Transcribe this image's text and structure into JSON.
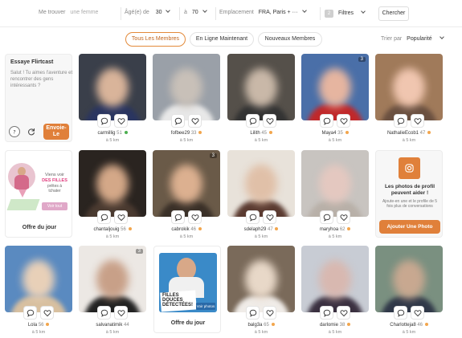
{
  "filters": {
    "me_trouver_label": "Me trouver",
    "me_trouver_value": "une femme",
    "age_label": "Âgé(e) de",
    "age_min": "30",
    "age_to": "à",
    "age_max": "70",
    "location_label": "Emplacement",
    "location_value": "FRA, Paris + ···",
    "filters_count": "2",
    "filters_label": "Filtres",
    "search_label": "Chercher"
  },
  "tabs": [
    {
      "label": "Tous Les Membres"
    },
    {
      "label": "En Ligne Maintenant"
    },
    {
      "label": "Nouveaux Membres"
    }
  ],
  "sort": {
    "label": "Trier par",
    "value": "Popularité"
  },
  "flirtcast": {
    "title": "Essaye Flirtcast",
    "text": "Salut ! Tu aimes l'aventure et rencontrer des gens intéressants ?",
    "send_label": "Envoie-Le"
  },
  "offer1": {
    "text1": "Viens voir",
    "highlight": "DES FILLES",
    "text2": "prêtes à tchater",
    "button": "Voir tout",
    "title": "Offre du jour"
  },
  "offer2": {
    "line1": "FILLES",
    "line2": "DOUCES",
    "line3": "DÉTECTÉES!",
    "button": "Voir photos",
    "title": "Offre du jour"
  },
  "photo_promo": {
    "title": "Les photos de profil peuvent aider !",
    "text": "Ajoute-en une et le profile de 5 fois plus de conversations",
    "button": "Ajouter Une Photo"
  },
  "members": [
    {
      "name": "carmillig",
      "age": "51",
      "dist": "à 5 km",
      "status": "green",
      "photos": "",
      "bg": "#3a3f4a",
      "face": "#d9b49a",
      "shirt": "#2a3560"
    },
    {
      "name": "fofbee29",
      "age": "33",
      "dist": "à 5 km",
      "status": "orange",
      "photos": "",
      "bg": "#9aa0a8",
      "face": "#c8c0b8",
      "shirt": "#e8e8e8"
    },
    {
      "name": "Lilith",
      "age": "45",
      "dist": "à 5 km",
      "status": "orange",
      "photos": "",
      "bg": "#55504a",
      "face": "#c9b8a8",
      "shirt": "#333"
    },
    {
      "name": "Maya4",
      "age": "35",
      "dist": "à 5 km",
      "status": "orange",
      "photos": "3",
      "bg": "#4a6fa8",
      "face": "#e6b5a0",
      "shirt": "#c0282a"
    },
    {
      "name": "NathalieEcob1",
      "age": "47",
      "dist": "à 5 km",
      "status": "orange",
      "photos": "",
      "bg": "#a07a5a",
      "face": "#f0c6b0",
      "shirt": "#6a5040"
    },
    {
      "name": "chantaljouig",
      "age": "56",
      "dist": "à 5 km",
      "status": "orange",
      "photos": "",
      "bg": "#2a2420",
      "face": "#d4a888",
      "shirt": "#4a3a30"
    },
    {
      "name": "cabrokik",
      "age": "46",
      "dist": "à 5 km",
      "status": "orange",
      "photos": "3",
      "bg": "#6a5a48",
      "face": "#dcb090",
      "shirt": "#3a3028"
    },
    {
      "name": "sdelaph29",
      "age": "47",
      "dist": "à 5 km",
      "status": "orange",
      "photos": "",
      "bg": "#e8e2da",
      "face": "#e0c0a8",
      "shirt": "#5a3a30"
    },
    {
      "name": "maryhoa",
      "age": "62",
      "dist": "à 5 km",
      "status": "orange",
      "photos": "",
      "bg": "#c8c4c0",
      "face": "#e4c8c0",
      "shirt": "#b8b0a8"
    },
    {
      "name": "Lola",
      "age": "56",
      "dist": "à 5 km",
      "status": "orange",
      "photos": "",
      "bg": "#5a8ac0",
      "face": "#e8d0b8",
      "shirt": "#d8c0a0"
    },
    {
      "name": "salvanatimik",
      "age": "44",
      "dist": "à 5 km",
      "status": "",
      "photos": "3",
      "bg": "#ece8e4",
      "face": "#c8a088",
      "shirt": "#222"
    },
    {
      "name": "balg3a",
      "age": "65",
      "dist": "à 5 km",
      "status": "orange",
      "photos": "",
      "bg": "#7a6a5a",
      "face": "#e8d8c8",
      "shirt": "#f0ece8"
    },
    {
      "name": "darlomie",
      "age": "38",
      "dist": "à 5 km",
      "status": "orange",
      "photos": "",
      "bg": "#c8ccd4",
      "face": "#d8b8b0",
      "shirt": "#3a3040"
    },
    {
      "name": "Charlotteja8",
      "age": "46",
      "dist": "à 5 km",
      "status": "orange",
      "photos": "",
      "bg": "#7a9080",
      "face": "#c8a890",
      "shirt": "#303848"
    }
  ],
  "icons": {
    "chat": "chat-bubble-icon",
    "like": "heart-icon",
    "help": "question-icon",
    "refresh": "refresh-icon",
    "camera": "camera-icon"
  },
  "accent": "#e0803a"
}
